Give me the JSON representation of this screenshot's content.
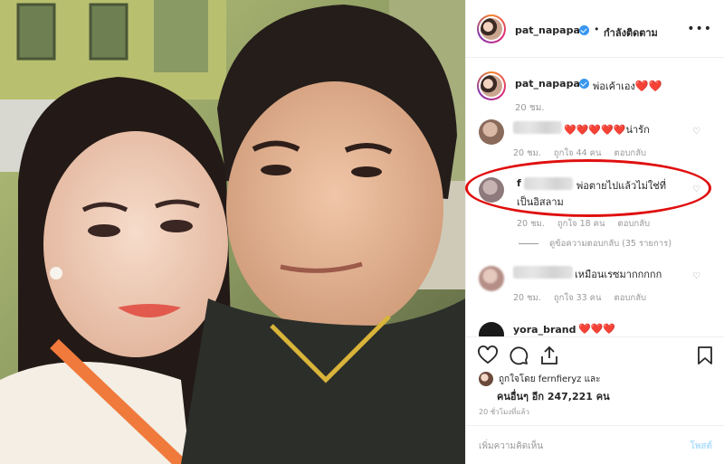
{
  "header": {
    "username": "pat_napapa",
    "separator": "•",
    "follow_status": "กำลังติดตาม",
    "more_icon": "more-horizontal-icon"
  },
  "caption": {
    "username": "pat_napapa",
    "text": "พ่อเค้าเอง",
    "emoji": "❤️❤️",
    "time": "20 ชม."
  },
  "comments": [
    {
      "text": "❤️❤️❤️❤️❤️น่ารัก",
      "time": "20 ชม.",
      "likes": "ถูกใจ 44 คน",
      "reply": "ตอบกลับ"
    },
    {
      "name_prefix": "f",
      "text_line1": "พ่อตายไปแล้วไม่ใช่ที่",
      "text_line2": "เป็นอิสลาม",
      "time": "20 ชม.",
      "likes": "ถูกใจ 18 คน",
      "reply": "ตอบกลับ"
    },
    {
      "text": "เหมือนเรซมากกกกก",
      "time": "20 ชม.",
      "likes": "ถูกใจ 33 คน",
      "reply": "ตอบกลับ"
    },
    {
      "username": "yora_brand",
      "text": "❤️❤️❤️"
    }
  ],
  "view_replies": "ดูข้อความตอบกลับ (35 รายการ)",
  "likes": {
    "line1": "ถูกใจโดย fernfieryz และ",
    "line2": "คนอื่นๆ อีก 247,221 คน"
  },
  "post_time": "20 ชั่วโมงที่แล้ว",
  "comment_box": {
    "placeholder": "เพิ่มความคิดเห็น",
    "post_label": "โพสต์"
  },
  "colors": {
    "verified": "#3897f0",
    "heart": "#e0211f",
    "highlight": "#e00f0f",
    "muted": "#999999"
  }
}
